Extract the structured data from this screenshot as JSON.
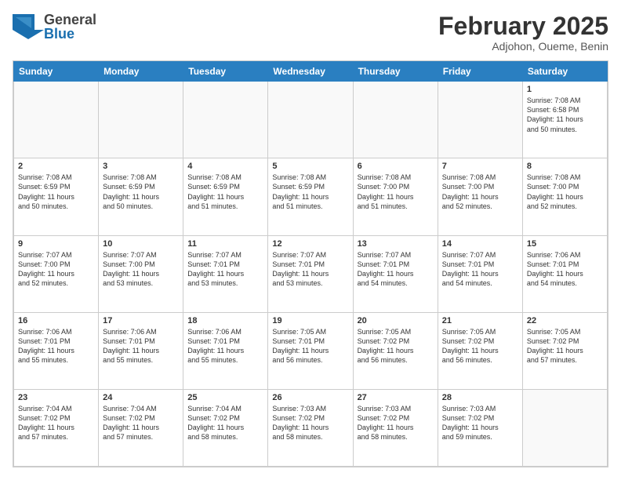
{
  "header": {
    "logo_general": "General",
    "logo_blue": "Blue",
    "month_year": "February 2025",
    "location": "Adjohon, Oueme, Benin"
  },
  "days_of_week": [
    "Sunday",
    "Monday",
    "Tuesday",
    "Wednesday",
    "Thursday",
    "Friday",
    "Saturday"
  ],
  "weeks": [
    [
      {
        "day": "",
        "info": ""
      },
      {
        "day": "",
        "info": ""
      },
      {
        "day": "",
        "info": ""
      },
      {
        "day": "",
        "info": ""
      },
      {
        "day": "",
        "info": ""
      },
      {
        "day": "",
        "info": ""
      },
      {
        "day": "1",
        "info": "Sunrise: 7:08 AM\nSunset: 6:58 PM\nDaylight: 11 hours\nand 50 minutes."
      }
    ],
    [
      {
        "day": "2",
        "info": "Sunrise: 7:08 AM\nSunset: 6:59 PM\nDaylight: 11 hours\nand 50 minutes."
      },
      {
        "day": "3",
        "info": "Sunrise: 7:08 AM\nSunset: 6:59 PM\nDaylight: 11 hours\nand 50 minutes."
      },
      {
        "day": "4",
        "info": "Sunrise: 7:08 AM\nSunset: 6:59 PM\nDaylight: 11 hours\nand 51 minutes."
      },
      {
        "day": "5",
        "info": "Sunrise: 7:08 AM\nSunset: 6:59 PM\nDaylight: 11 hours\nand 51 minutes."
      },
      {
        "day": "6",
        "info": "Sunrise: 7:08 AM\nSunset: 7:00 PM\nDaylight: 11 hours\nand 51 minutes."
      },
      {
        "day": "7",
        "info": "Sunrise: 7:08 AM\nSunset: 7:00 PM\nDaylight: 11 hours\nand 52 minutes."
      },
      {
        "day": "8",
        "info": "Sunrise: 7:08 AM\nSunset: 7:00 PM\nDaylight: 11 hours\nand 52 minutes."
      }
    ],
    [
      {
        "day": "9",
        "info": "Sunrise: 7:07 AM\nSunset: 7:00 PM\nDaylight: 11 hours\nand 52 minutes."
      },
      {
        "day": "10",
        "info": "Sunrise: 7:07 AM\nSunset: 7:00 PM\nDaylight: 11 hours\nand 53 minutes."
      },
      {
        "day": "11",
        "info": "Sunrise: 7:07 AM\nSunset: 7:01 PM\nDaylight: 11 hours\nand 53 minutes."
      },
      {
        "day": "12",
        "info": "Sunrise: 7:07 AM\nSunset: 7:01 PM\nDaylight: 11 hours\nand 53 minutes."
      },
      {
        "day": "13",
        "info": "Sunrise: 7:07 AM\nSunset: 7:01 PM\nDaylight: 11 hours\nand 54 minutes."
      },
      {
        "day": "14",
        "info": "Sunrise: 7:07 AM\nSunset: 7:01 PM\nDaylight: 11 hours\nand 54 minutes."
      },
      {
        "day": "15",
        "info": "Sunrise: 7:06 AM\nSunset: 7:01 PM\nDaylight: 11 hours\nand 54 minutes."
      }
    ],
    [
      {
        "day": "16",
        "info": "Sunrise: 7:06 AM\nSunset: 7:01 PM\nDaylight: 11 hours\nand 55 minutes."
      },
      {
        "day": "17",
        "info": "Sunrise: 7:06 AM\nSunset: 7:01 PM\nDaylight: 11 hours\nand 55 minutes."
      },
      {
        "day": "18",
        "info": "Sunrise: 7:06 AM\nSunset: 7:01 PM\nDaylight: 11 hours\nand 55 minutes."
      },
      {
        "day": "19",
        "info": "Sunrise: 7:05 AM\nSunset: 7:01 PM\nDaylight: 11 hours\nand 56 minutes."
      },
      {
        "day": "20",
        "info": "Sunrise: 7:05 AM\nSunset: 7:02 PM\nDaylight: 11 hours\nand 56 minutes."
      },
      {
        "day": "21",
        "info": "Sunrise: 7:05 AM\nSunset: 7:02 PM\nDaylight: 11 hours\nand 56 minutes."
      },
      {
        "day": "22",
        "info": "Sunrise: 7:05 AM\nSunset: 7:02 PM\nDaylight: 11 hours\nand 57 minutes."
      }
    ],
    [
      {
        "day": "23",
        "info": "Sunrise: 7:04 AM\nSunset: 7:02 PM\nDaylight: 11 hours\nand 57 minutes."
      },
      {
        "day": "24",
        "info": "Sunrise: 7:04 AM\nSunset: 7:02 PM\nDaylight: 11 hours\nand 57 minutes."
      },
      {
        "day": "25",
        "info": "Sunrise: 7:04 AM\nSunset: 7:02 PM\nDaylight: 11 hours\nand 58 minutes."
      },
      {
        "day": "26",
        "info": "Sunrise: 7:03 AM\nSunset: 7:02 PM\nDaylight: 11 hours\nand 58 minutes."
      },
      {
        "day": "27",
        "info": "Sunrise: 7:03 AM\nSunset: 7:02 PM\nDaylight: 11 hours\nand 58 minutes."
      },
      {
        "day": "28",
        "info": "Sunrise: 7:03 AM\nSunset: 7:02 PM\nDaylight: 11 hours\nand 59 minutes."
      },
      {
        "day": "",
        "info": ""
      }
    ]
  ]
}
